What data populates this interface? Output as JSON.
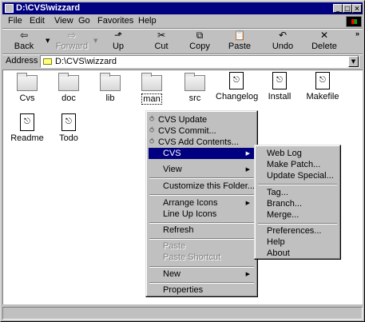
{
  "window": {
    "title": "D:\\CVS\\wizzard"
  },
  "title_buttons": [
    "_",
    "□",
    "×"
  ],
  "menubar": [
    "File",
    "Edit",
    "View",
    "Go",
    "Favorites",
    "Help"
  ],
  "toolbar": {
    "back": "Back",
    "forward": "Forward",
    "up": "Up",
    "cut": "Cut",
    "copy": "Copy",
    "paste": "Paste",
    "undo": "Undo",
    "delete": "Delete",
    "more": "»"
  },
  "address": {
    "label": "Address",
    "value": "D:\\CVS\\wizzard"
  },
  "files": [
    {
      "name": "Cvs",
      "type": "folder"
    },
    {
      "name": "doc",
      "type": "folder"
    },
    {
      "name": "lib",
      "type": "folder"
    },
    {
      "name": "man",
      "type": "folder"
    },
    {
      "name": "src",
      "type": "folder"
    },
    {
      "name": "Changelog",
      "type": "file"
    },
    {
      "name": "Install",
      "type": "file"
    },
    {
      "name": "Makefile",
      "type": "file"
    },
    {
      "name": "Readme",
      "type": "file"
    },
    {
      "name": "Todo",
      "type": "file"
    }
  ],
  "context_menu": {
    "cvs_update": "CVS Update",
    "cvs_commit": "CVS Commit...",
    "cvs_add": "CVS Add Contents...",
    "cvs": "CVS",
    "view": "View",
    "customize": "Customize this Folder...",
    "arrange": "Arrange Icons",
    "lineup": "Line Up Icons",
    "refresh": "Refresh",
    "paste": "Paste",
    "paste_shortcut": "Paste Shortcut",
    "new": "New",
    "properties": "Properties"
  },
  "cvs_submenu": {
    "web_log": "Web Log",
    "make_patch": "Make Patch...",
    "update_special": "Update Special...",
    "tag": "Tag...",
    "branch": "Branch...",
    "merge": "Merge...",
    "preferences": "Preferences...",
    "help": "Help",
    "about": "About"
  },
  "colors": {
    "highlight": "#000080",
    "face": "#c0c0c0",
    "title": "#000080"
  }
}
